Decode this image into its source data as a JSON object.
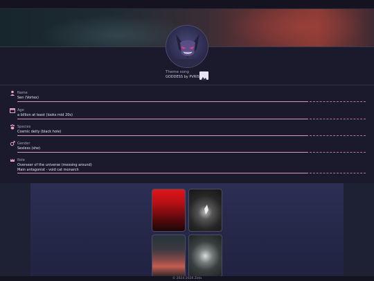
{
  "theme": {
    "label": "Theme song",
    "value": "GODDESS by PVRIS"
  },
  "fields": [
    {
      "label": "Name",
      "value": "Sen (Vortex)",
      "icon": "person-icon"
    },
    {
      "label": "Age",
      "value": "a billion at least (looks mid 20s)",
      "icon": "calendar-icon"
    },
    {
      "label": "Species",
      "value": "Cosmic deity (black hole)",
      "icon": "paw-icon"
    },
    {
      "label": "Gender",
      "value": "Sexless (she)",
      "icon": "gender-icon"
    },
    {
      "label": "Role",
      "value_line1": "Overseer of the universe (messing around)",
      "value_line2": "Main antagonist - void cat monarch",
      "icon": "crown-icon"
    }
  ],
  "footer": "© 2024-2026 Zeta",
  "colors": {
    "accent": "#d89ab6",
    "background": "#1b1a2c"
  }
}
